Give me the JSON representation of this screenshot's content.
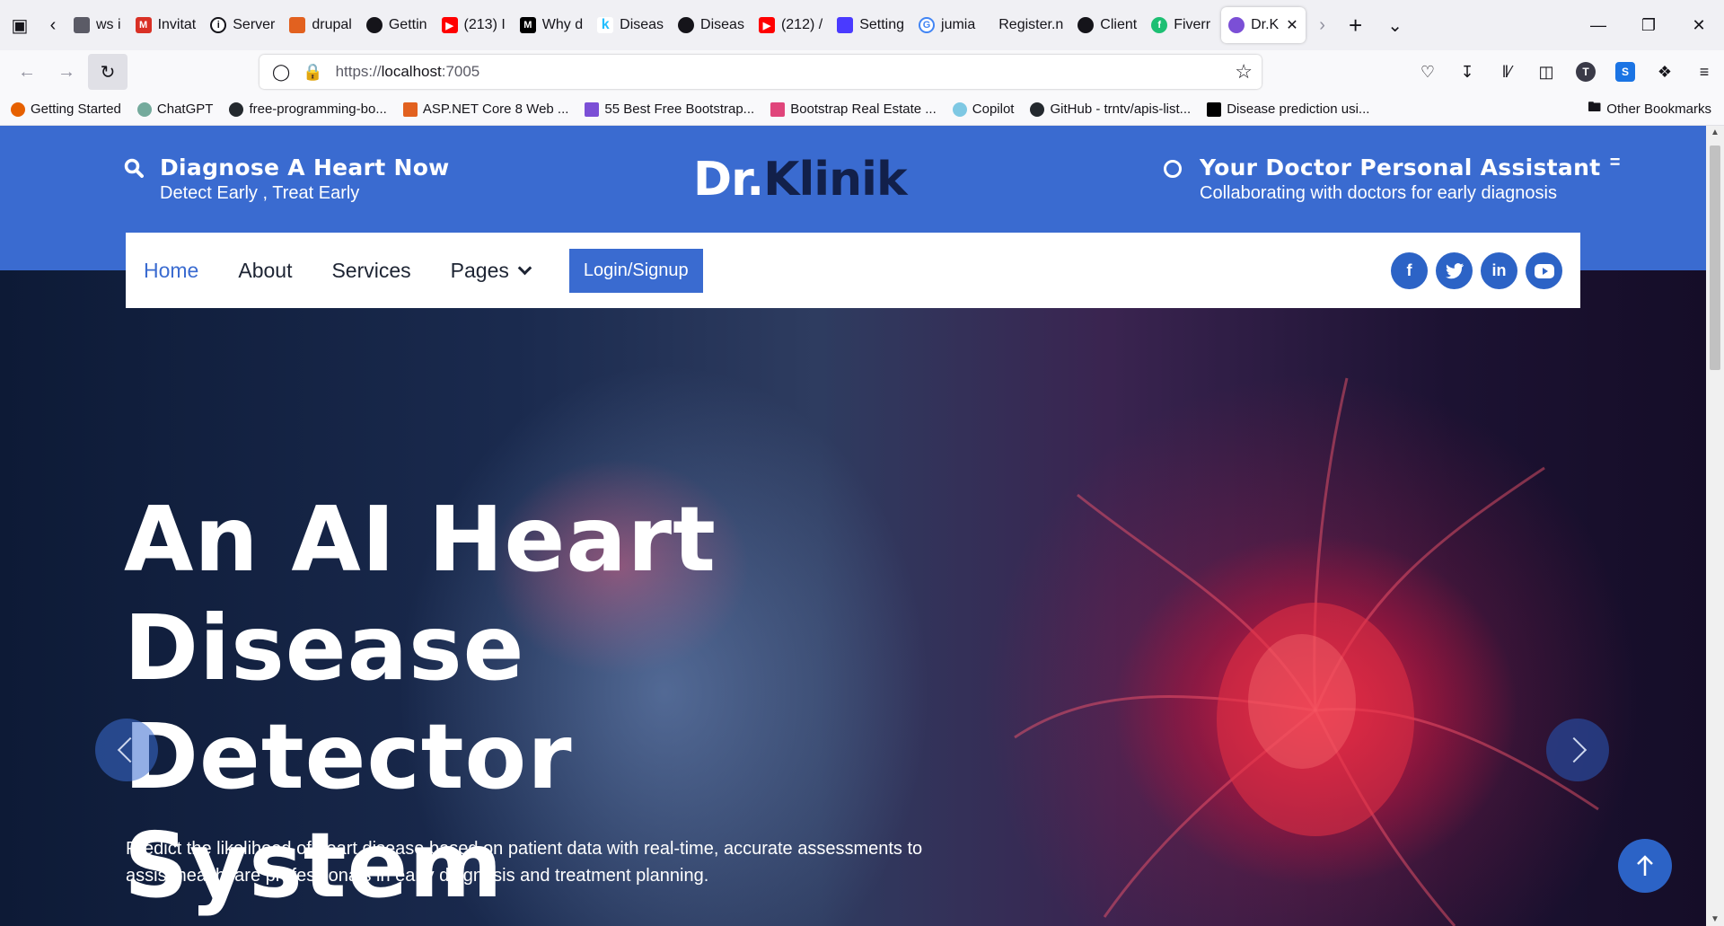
{
  "browser": {
    "tabs": [
      {
        "label": "ws i",
        "fav": "article-icon",
        "color": "#5b5b66"
      },
      {
        "label": "Invitat",
        "fav": "gmail-icon",
        "color": "#d93025"
      },
      {
        "label": "Server",
        "fav": "info-icon",
        "color": "#5b5b66"
      },
      {
        "label": "drupal",
        "fav": "drupal-icon",
        "color": "#e2611f"
      },
      {
        "label": "Gettin",
        "fav": "github-icon",
        "color": "#15141a"
      },
      {
        "label": "(213) I",
        "fav": "youtube-icon",
        "color": "#ff0000"
      },
      {
        "label": "Why d",
        "fav": "medium-icon",
        "color": "#000000"
      },
      {
        "label": "Diseas",
        "fav": "kaggle-icon",
        "color": "#20beff"
      },
      {
        "label": "Diseas",
        "fav": "github-icon",
        "color": "#15141a"
      },
      {
        "label": "(212) /",
        "fav": "youtube-icon",
        "color": "#ff0000"
      },
      {
        "label": "Setting",
        "fav": "settings-icon",
        "color": "#4a3aff"
      },
      {
        "label": "jumia",
        "fav": "google-icon",
        "color": "#4285f4"
      },
      {
        "label": "Register.n",
        "fav": "",
        "color": "#5b5b66"
      },
      {
        "label": "Client",
        "fav": "openai-icon",
        "color": "#15141a"
      },
      {
        "label": "Fiverr",
        "fav": "fiverr-icon",
        "color": "#1dbf73"
      },
      {
        "label": "Dr.K",
        "fav": "site-icon",
        "color": "#7b4fd6",
        "active": true
      }
    ],
    "url": {
      "scheme": "https://",
      "host": "localhost",
      "port": ":7005"
    },
    "bookmarks": [
      {
        "label": "Getting Started",
        "color": "#e66000"
      },
      {
        "label": "ChatGPT",
        "color": "#74aa9c"
      },
      {
        "label": "free-programming-bo...",
        "color": "#24292e"
      },
      {
        "label": "ASP.NET Core 8 Web ...",
        "color": "#e2611f"
      },
      {
        "label": "55 Best Free Bootstrap...",
        "color": "#7b4fd6"
      },
      {
        "label": "Bootstrap Real Estate ...",
        "color": "#e0457b"
      },
      {
        "label": "Copilot",
        "color": "#7ec8e3"
      },
      {
        "label": "GitHub - trntv/apis-list...",
        "color": "#24292e"
      },
      {
        "label": "Disease prediction usi...",
        "color": "#000000"
      }
    ],
    "other_bookmarks": "Other Bookmarks",
    "avatar_letter": "T",
    "ext_letter": "S"
  },
  "header": {
    "left_title": "Diagnose A Heart Now",
    "left_sub": "Detect Early , Treat Early",
    "brand_part1": "Dr.",
    "brand_part2": "Klinik",
    "right_title": "Your Doctor Personal Assistant",
    "right_sub": "Collaborating with doctors for early diagnosis"
  },
  "menu": {
    "items": [
      "Home",
      "About",
      "Services",
      "Pages"
    ],
    "login": "Login/Signup",
    "socials": [
      "facebook-icon",
      "twitter-icon",
      "linkedin-icon",
      "youtube-icon"
    ]
  },
  "hero": {
    "title_lines": [
      "An AI Heart",
      "Disease Detector",
      "System"
    ],
    "description": "Predict the likelihood of heart disease based on patient data with real-time, accurate assessments to assist healthcare professionals in early diagnosis and treatment planning."
  },
  "colors": {
    "brand_blue": "#3a6bd0",
    "brand_dark": "#12204a"
  }
}
